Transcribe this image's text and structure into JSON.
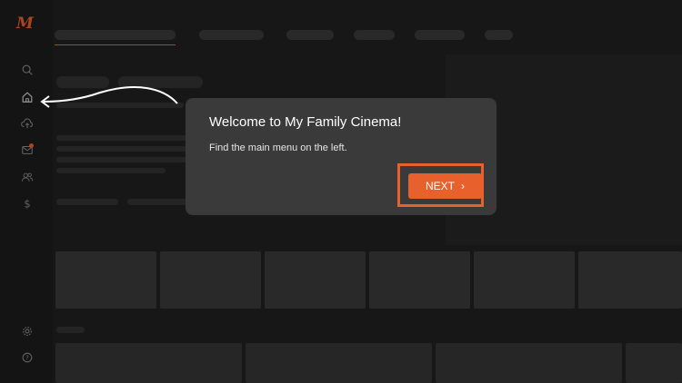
{
  "app": {
    "logo_text": "M"
  },
  "sidebar": {
    "items": [
      {
        "name": "search",
        "icon": "search-icon"
      },
      {
        "name": "home",
        "icon": "home-icon"
      },
      {
        "name": "upload",
        "icon": "cloud-upload-icon"
      },
      {
        "name": "messages",
        "icon": "mail-icon",
        "badge": true
      },
      {
        "name": "users",
        "icon": "users-icon"
      },
      {
        "name": "billing",
        "icon": "dollar-icon"
      },
      {
        "name": "settings",
        "icon": "gear-icon"
      },
      {
        "name": "help",
        "icon": "help-icon"
      }
    ]
  },
  "dialog": {
    "title": "Welcome to My Family Cinema!",
    "message": "Find the main menu on the left.",
    "next_label": "NEXT",
    "next_icon": "chevron-right-icon"
  },
  "colors": {
    "accent": "#e8612c",
    "background": "#202020",
    "dialog": "#3a3a3a"
  }
}
